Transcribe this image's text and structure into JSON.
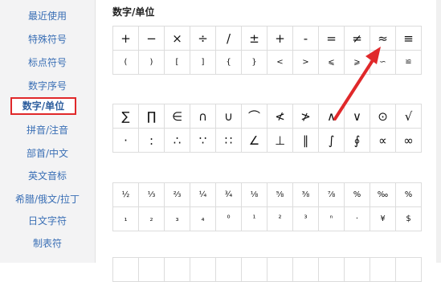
{
  "sidebar": {
    "items": [
      {
        "label": "最近使用",
        "active": false
      },
      {
        "label": "特殊符号",
        "active": false
      },
      {
        "label": "标点符号",
        "active": false
      },
      {
        "label": "数字序号",
        "active": false
      },
      {
        "label": "数字/单位",
        "active": true
      },
      {
        "label": "拼音/注音",
        "active": false
      },
      {
        "label": "部首/中文",
        "active": false
      },
      {
        "label": "英文音标",
        "active": false
      },
      {
        "label": "希腊/俄文/拉丁",
        "active": false
      },
      {
        "label": "日文字符",
        "active": false
      },
      {
        "label": "制表符",
        "active": false
      }
    ]
  },
  "section": {
    "title": "数字/单位"
  },
  "grid1": [
    [
      "+",
      "−",
      "×",
      "÷",
      "/",
      "±",
      "+",
      "-",
      "=",
      "≠",
      "≈",
      "≡"
    ],
    [
      "(",
      ")",
      "[",
      "]",
      "{",
      "}",
      "<",
      ">",
      "⩽",
      "⩾",
      "∽",
      "≌"
    ]
  ],
  "grid2": [
    [
      "∑",
      "∏",
      "∈",
      "∩",
      "∪",
      "⌒",
      "≮",
      "≯",
      "∧",
      "∨",
      "⊙",
      "√"
    ],
    [
      "·",
      ":",
      "∴",
      "∵",
      "∷",
      "∠",
      "⊥",
      "∥",
      "∫",
      "∮",
      "∝",
      "∞"
    ]
  ],
  "grid3": [
    [
      "½",
      "⅓",
      "⅔",
      "¼",
      "¾",
      "⅛",
      "⅝",
      "⅜",
      "⅞",
      "%",
      "‰",
      "%"
    ],
    [
      "₁",
      "₂",
      "₃",
      "₄",
      "⁰",
      "¹",
      "²",
      "³",
      "ⁿ",
      "·",
      "¥",
      "$"
    ]
  ],
  "colors": {
    "accent": "#3a6fb5",
    "highlight": "#e0282a"
  }
}
